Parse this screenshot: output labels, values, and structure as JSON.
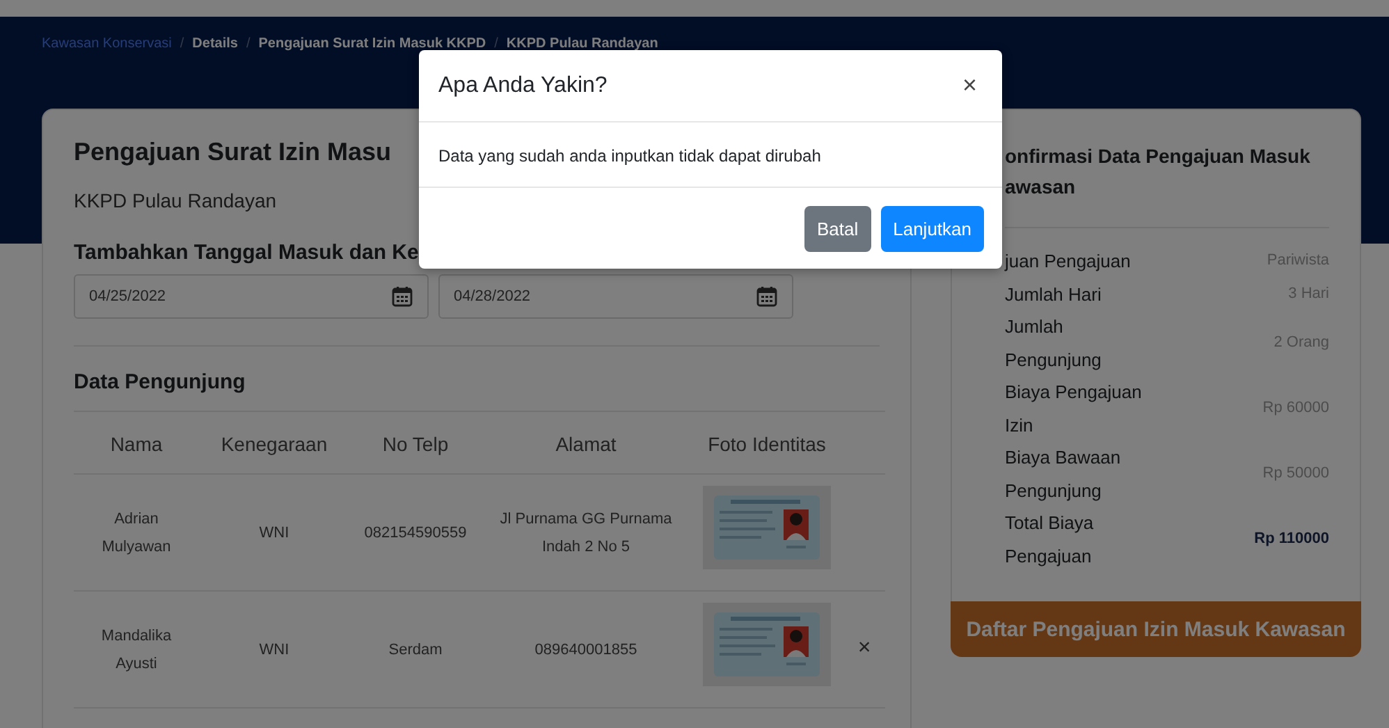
{
  "breadcrumb": [
    {
      "label": "Kawasan Konservasi",
      "kind": "link"
    },
    {
      "label": "Details",
      "kind": "crumb"
    },
    {
      "label": "Pengajuan Surat Izin Masuk KKPD",
      "kind": "crumb"
    },
    {
      "label": "KKPD Pulau Randayan",
      "kind": "crumb"
    }
  ],
  "breadcrumb_separator": "/",
  "form_card": {
    "title": "Pengajuan Surat Izin Masu",
    "subtitle": "KKPD Pulau Randayan",
    "date_heading": "Tambahkan Tanggal Masuk dan Ke",
    "dates": [
      {
        "value": "04/25/2022"
      },
      {
        "value": "04/28/2022"
      }
    ],
    "visitors_heading": "Data Pengunjung",
    "table": {
      "columns": [
        "Nama",
        "Kenegaraan",
        "No Telp",
        "Alamat",
        "Foto Identitas"
      ],
      "rows": [
        {
          "cells": [
            "Adrian Mulyawan",
            "WNI",
            "082154590559",
            "Jl Purnama GG Purnama Indah 2 No 5"
          ],
          "photo": {
            "kind": "picture"
          }
        },
        {
          "cells": [
            "Mandalika Ayusti",
            "WNI",
            "Serdam",
            "089640001855"
          ],
          "photo": {
            "kind": "picture"
          },
          "delete": "×"
        }
      ]
    }
  },
  "summary_card": {
    "title_lines": [
      "onfirmasi Data Pengajuan Masuk",
      "awasan"
    ],
    "rows": [
      {
        "label": "juan Pengajuan",
        "value": "Pariwista",
        "emphasis": false
      },
      {
        "label": "Jumlah Hari",
        "value": "3 Hari",
        "emphasis": false
      },
      {
        "label": "Jumlah Pengunjung",
        "value": "2 Orang",
        "emphasis": false
      },
      {
        "label": "Biaya Pengajuan Izin",
        "value": "Rp 60000",
        "emphasis": false
      },
      {
        "label": "Biaya Bawaan Pengunjung",
        "value": "Rp 50000",
        "emphasis": false
      },
      {
        "label": "Total Biaya Pengajuan",
        "value": "Rp 110000",
        "emphasis": true
      }
    ],
    "button": "Daftar Pengajuan Izin Masuk Kawasan"
  },
  "modal": {
    "title": "Apa Anda Yakin?",
    "close": "×",
    "message": "Data yang sudah anda inputkan tidak dapat dirubah",
    "buttons": [
      {
        "label": "Batal",
        "kind": "secondary"
      },
      {
        "label": "Lanjutkan",
        "kind": "primary"
      }
    ]
  }
}
